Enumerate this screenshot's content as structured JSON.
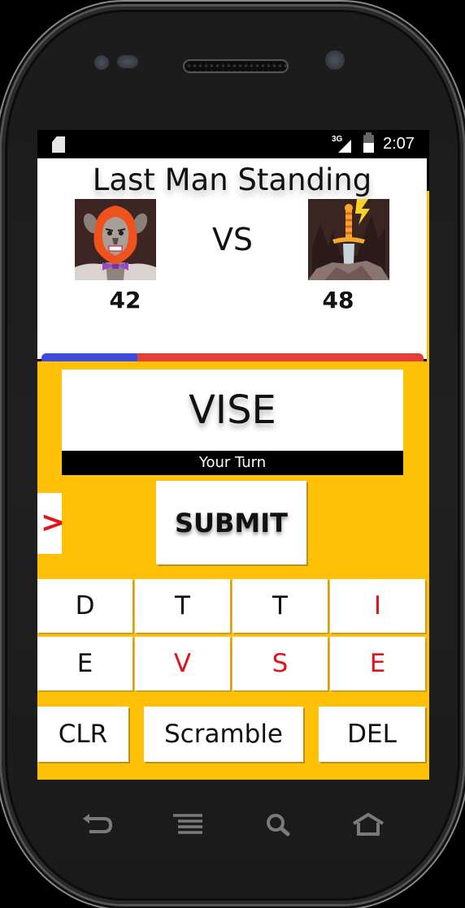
{
  "status_bar": {
    "network": "3G",
    "time": "2:07",
    "icons": [
      "sd-card-icon",
      "signal-icon",
      "battery-charging-icon"
    ]
  },
  "game": {
    "title": "Last Man Standing",
    "vs_label": "VS",
    "player_left": {
      "avatar": "werewolf-avatar",
      "score": "42"
    },
    "player_right": {
      "avatar": "sword-in-stone-avatar",
      "score": "48"
    },
    "health_bar": {
      "left_share_percent": 25,
      "left_color": "#3b4be0",
      "right_color": "#e53d3a"
    },
    "current_word": "VISE",
    "turn_label": "Your Turn",
    "expand_arrow": ">",
    "submit_label": "SUBMIT",
    "tiles": [
      {
        "letter": "D",
        "used": false
      },
      {
        "letter": "T",
        "used": false
      },
      {
        "letter": "T",
        "used": false
      },
      {
        "letter": "I",
        "used": true
      },
      {
        "letter": "E",
        "used": false
      },
      {
        "letter": "V",
        "used": true
      },
      {
        "letter": "S",
        "used": true
      },
      {
        "letter": "E",
        "used": true
      }
    ],
    "controls": {
      "clear_label": "CLR",
      "scramble_label": "Scramble",
      "delete_label": "DEL"
    },
    "colors": {
      "accent_yellow": "#ffc107",
      "used_letter": "#e0141a"
    }
  },
  "nav_bar": [
    "back-icon",
    "menu-icon",
    "search-icon",
    "home-icon"
  ]
}
